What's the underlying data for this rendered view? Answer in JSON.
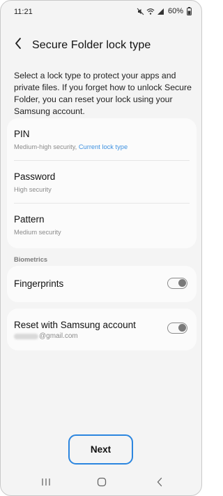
{
  "status_bar": {
    "time": "11:21",
    "battery": "60%",
    "icons": [
      "mute-icon",
      "wifi-icon",
      "signal-icon",
      "battery-icon"
    ]
  },
  "header": {
    "back_icon": "chevron-left-icon",
    "title": "Secure Folder lock type"
  },
  "description": "Select a lock type to protect your apps and private files. If you forget how to unlock Secure Folder, you can reset your lock using your Samsung account.",
  "lock_types": [
    {
      "title": "PIN",
      "subtitle": "Medium-high security,",
      "current": "Current lock type"
    },
    {
      "title": "Password",
      "subtitle": "High security"
    },
    {
      "title": "Pattern",
      "subtitle": "Medium security"
    }
  ],
  "biometrics": {
    "header": "Biometrics",
    "fingerprints": {
      "label": "Fingerprints",
      "enabled": false
    }
  },
  "reset": {
    "label": "Reset with Samsung account",
    "email_domain": "@gmail.com",
    "enabled": false
  },
  "next_label": "Next",
  "nav_bar": {
    "icons": [
      "recents-icon",
      "home-icon",
      "back-icon"
    ]
  },
  "colors": {
    "accent": "#2c86df",
    "link": "#3e91e0",
    "background": "#f4f4f4",
    "card": "#fbfbfb"
  }
}
